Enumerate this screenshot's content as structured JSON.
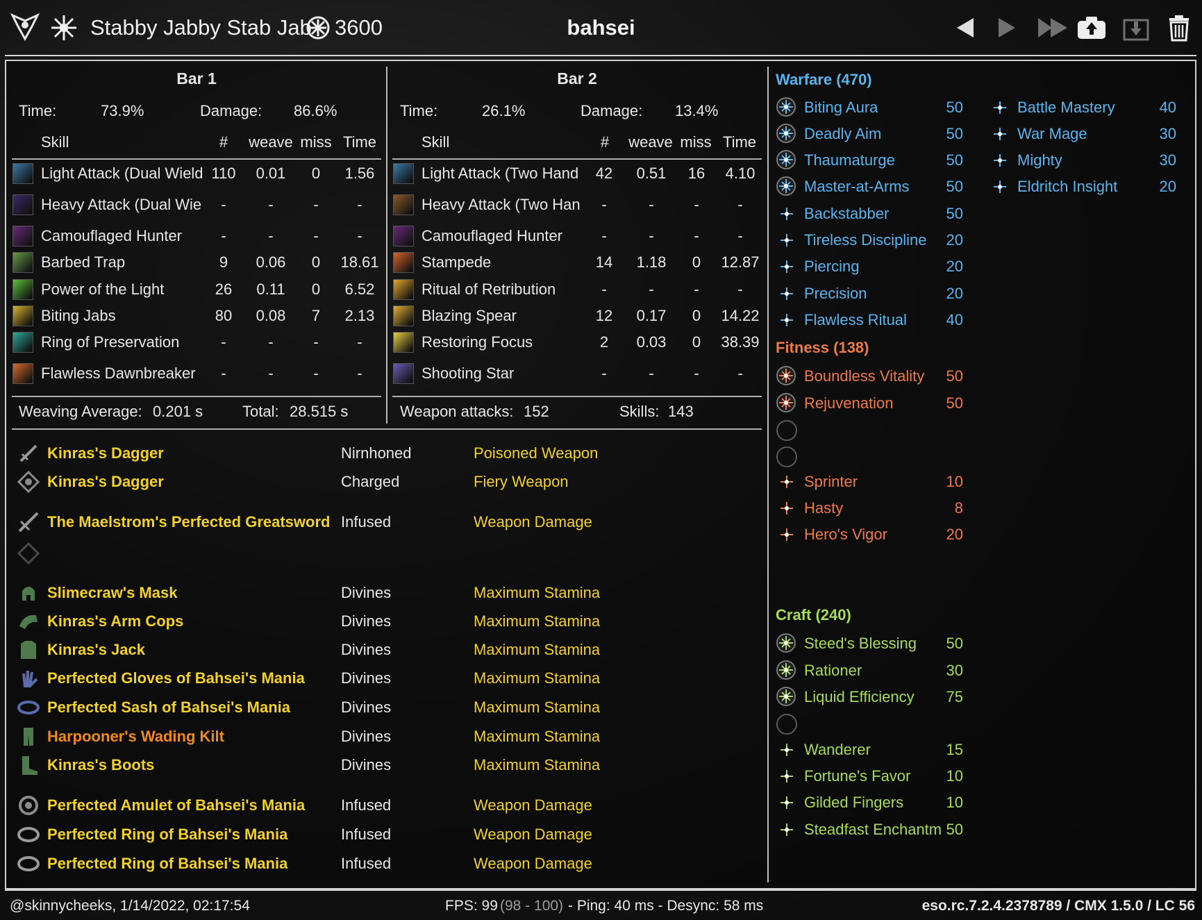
{
  "header": {
    "fight_name": "Stabby Jabby Stab Jab",
    "cp_total": "3600",
    "character": "bahsei",
    "icons": [
      "class-icon",
      "fight-type-icon",
      "cp-icon",
      "prev-icon",
      "next-icon",
      "last-icon",
      "upload-icon",
      "download-icon",
      "trash-icon"
    ]
  },
  "bar1": {
    "title": "Bar 1",
    "time_label": "Time:",
    "time": "73.9%",
    "damage_label": "Damage:",
    "damage": "86.6%",
    "columns": [
      "Skill",
      "#",
      "weave",
      "miss",
      "Time"
    ],
    "skills": [
      {
        "name": "Light Attack (Dual Wield",
        "count": "110",
        "weave": "0.01",
        "miss": "0",
        "time": "1.56",
        "color": "#3a7aa8"
      },
      {
        "name": "Heavy Attack (Dual Wie",
        "count": "-",
        "weave": "-",
        "miss": "-",
        "time": "-",
        "color": "#3b2a6a"
      },
      {
        "name": "Camouflaged Hunter",
        "count": "-",
        "weave": "-",
        "miss": "-",
        "time": "-",
        "color": "#6a2a7a"
      },
      {
        "name": "Barbed Trap",
        "count": "9",
        "weave": "0.06",
        "miss": "0",
        "time": "18.61",
        "color": "#6a9a4a"
      },
      {
        "name": "Power of the Light",
        "count": "26",
        "weave": "0.11",
        "miss": "0",
        "time": "6.52",
        "color": "#5cbf3a"
      },
      {
        "name": "Biting Jabs",
        "count": "80",
        "weave": "0.08",
        "miss": "7",
        "time": "2.13",
        "color": "#d8b22a"
      },
      {
        "name": "Ring of Preservation",
        "count": "-",
        "weave": "-",
        "miss": "-",
        "time": "-",
        "color": "#2aa89a"
      },
      {
        "name": "Flawless Dawnbreaker",
        "count": "-",
        "weave": "-",
        "miss": "-",
        "time": "-",
        "color": "#d86a2a"
      }
    ],
    "footer_left_label": "Weaving Average:",
    "footer_left_value": "0.201 s",
    "footer_right_label": "Total:",
    "footer_right_value": "28.515 s"
  },
  "bar2": {
    "title": "Bar 2",
    "time_label": "Time:",
    "time": "26.1%",
    "damage_label": "Damage:",
    "damage": "13.4%",
    "columns": [
      "Skill",
      "#",
      "weave",
      "miss",
      "Time"
    ],
    "skills": [
      {
        "name": "Light Attack (Two Hand",
        "count": "42",
        "weave": "0.51",
        "miss": "16",
        "time": "4.10",
        "color": "#3a7aa8"
      },
      {
        "name": "Heavy Attack (Two Han",
        "count": "-",
        "weave": "-",
        "miss": "-",
        "time": "-",
        "color": "#8a5a2a"
      },
      {
        "name": "Camouflaged Hunter",
        "count": "-",
        "weave": "-",
        "miss": "-",
        "time": "-",
        "color": "#6a2a7a"
      },
      {
        "name": "Stampede",
        "count": "14",
        "weave": "1.18",
        "miss": "0",
        "time": "12.87",
        "color": "#d8642a"
      },
      {
        "name": "Ritual of Retribution",
        "count": "-",
        "weave": "-",
        "miss": "-",
        "time": "-",
        "color": "#e8a82a"
      },
      {
        "name": "Blazing Spear",
        "count": "12",
        "weave": "0.17",
        "miss": "0",
        "time": "14.22",
        "color": "#e0b030"
      },
      {
        "name": "Restoring Focus",
        "count": "2",
        "weave": "0.03",
        "miss": "0",
        "time": "38.39",
        "color": "#e8d040"
      },
      {
        "name": "Shooting Star",
        "count": "-",
        "weave": "-",
        "miss": "-",
        "time": "-",
        "color": "#6a5ab8"
      }
    ],
    "footer_left_label": "Weapon attacks:",
    "footer_left_value": "152",
    "footer_right_label": "Skills:",
    "footer_right_value": "143"
  },
  "gear": [
    {
      "icon": "dagger-icon",
      "name": "Kinras's Dagger",
      "trait": "Nirnhoned",
      "enchant": "Poisoned Weapon",
      "name_color": "#f2d12a"
    },
    {
      "icon": "dagger-back-icon",
      "name": "Kinras's Dagger",
      "trait": "Charged",
      "enchant": "Fiery Weapon",
      "name_color": "#f2d12a"
    },
    {
      "icon": "greatsword-icon",
      "name": "The Maelstrom's Perfected Greatsword",
      "trait": "Infused",
      "enchant": "Weapon Damage",
      "name_color": "#f2d12a"
    },
    {
      "icon": "empty-backbar-icon",
      "name": "",
      "trait": "",
      "enchant": "",
      "name_color": "#f2d12a"
    },
    {
      "icon": "helmet-icon",
      "name": "Slimecraw's Mask",
      "trait": "Divines",
      "enchant": "Maximum Stamina",
      "name_color": "#f2d12a"
    },
    {
      "icon": "shoulder-icon",
      "name": "Kinras's Arm Cops",
      "trait": "Divines",
      "enchant": "Maximum Stamina",
      "name_color": "#f2d12a"
    },
    {
      "icon": "chest-icon",
      "name": "Kinras's Jack",
      "trait": "Divines",
      "enchant": "Maximum Stamina",
      "name_color": "#f2d12a"
    },
    {
      "icon": "gloves-icon",
      "name": "Perfected Gloves of Bahsei's Mania",
      "trait": "Divines",
      "enchant": "Maximum Stamina",
      "name_color": "#f2d12a"
    },
    {
      "icon": "belt-icon",
      "name": "Perfected Sash of Bahsei's Mania",
      "trait": "Divines",
      "enchant": "Maximum Stamina",
      "name_color": "#f2d12a"
    },
    {
      "icon": "legs-icon",
      "name": "Harpooner's Wading Kilt",
      "trait": "Divines",
      "enchant": "Maximum Stamina",
      "name_color": "#f08a1a"
    },
    {
      "icon": "boots-icon",
      "name": "Kinras's Boots",
      "trait": "Divines",
      "enchant": "Maximum Stamina",
      "name_color": "#f2d12a"
    },
    {
      "icon": "amulet-icon",
      "name": "Perfected Amulet of Bahsei's Mania",
      "trait": "Infused",
      "enchant": "Weapon Damage",
      "name_color": "#f2d12a"
    },
    {
      "icon": "ring-icon",
      "name": "Perfected Ring of Bahsei's Mania",
      "trait": "Infused",
      "enchant": "Weapon Damage",
      "name_color": "#f2d12a"
    },
    {
      "icon": "ring-icon",
      "name": "Perfected Ring of Bahsei's Mania",
      "trait": "Infused",
      "enchant": "Weapon Damage",
      "name_color": "#f2d12a"
    }
  ],
  "cp": {
    "warfare": {
      "title": "Warfare (470)",
      "color": "#5ab4ee",
      "slotted": [
        {
          "name": "Biting Aura",
          "value": "50"
        },
        {
          "name": "Deadly Aim",
          "value": "50"
        },
        {
          "name": "Thaumaturge",
          "value": "50"
        },
        {
          "name": "Master-at-Arms",
          "value": "50"
        }
      ],
      "passive": [
        {
          "name": "Backstabber",
          "value": "50"
        },
        {
          "name": "Tireless Discipline",
          "value": "20"
        },
        {
          "name": "Piercing",
          "value": "20"
        },
        {
          "name": "Precision",
          "value": "20"
        },
        {
          "name": "Flawless Ritual",
          "value": "40"
        }
      ],
      "right": [
        {
          "name": "Battle Mastery",
          "value": "40"
        },
        {
          "name": "War Mage",
          "value": "30"
        },
        {
          "name": "Mighty",
          "value": "30"
        },
        {
          "name": "Eldritch Insight",
          "value": "20"
        }
      ]
    },
    "fitness": {
      "title": "Fitness (138)",
      "color": "#ee7a4a",
      "slotted": [
        {
          "name": "Boundless Vitality",
          "value": "50"
        },
        {
          "name": "Rejuvenation",
          "value": "50"
        }
      ],
      "passive": [
        {
          "name": "Sprinter",
          "value": "10"
        },
        {
          "name": "Hasty",
          "value": "8"
        },
        {
          "name": "Hero's Vigor",
          "value": "20"
        }
      ]
    },
    "craft": {
      "title": "Craft (240)",
      "color": "#a6dc5a",
      "slotted": [
        {
          "name": "Steed's Blessing",
          "value": "50"
        },
        {
          "name": "Rationer",
          "value": "30"
        },
        {
          "name": "Liquid Efficiency",
          "value": "75"
        }
      ],
      "passive": [
        {
          "name": "Wanderer",
          "value": "15"
        },
        {
          "name": "Fortune's Favor",
          "value": "10"
        },
        {
          "name": "Gilded Fingers",
          "value": "10"
        },
        {
          "name": "Steadfast Enchantm",
          "value": "50"
        }
      ]
    }
  },
  "footer": {
    "user_time": "@skinnycheeks, 1/14/2022, 02:17:54",
    "fps_label": "FPS: 99",
    "fps_range": "(98 - 100)",
    "ping_desync": "- Ping: 40 ms - Desync: 58 ms",
    "version": "eso.rc.7.2.4.2378789 / CMX 1.5.0 / LC 56"
  }
}
